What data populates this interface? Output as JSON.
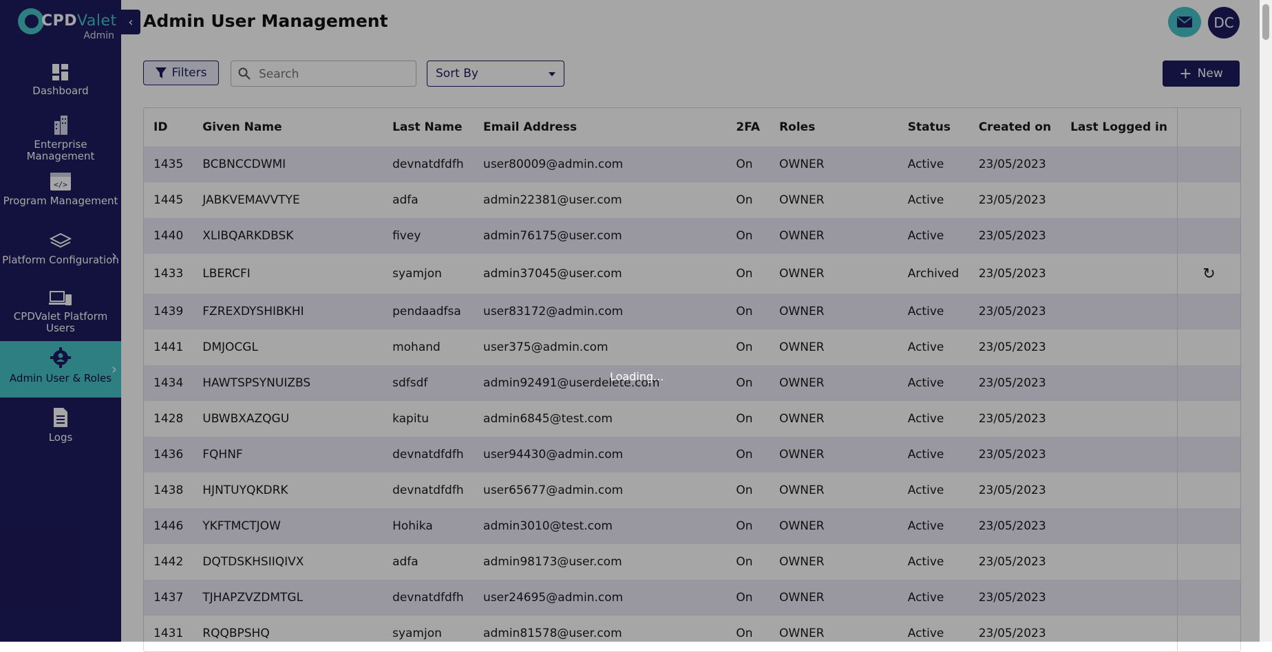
{
  "brand": {
    "name_prefix": "CPD",
    "name_suffix": "Valet",
    "sub": "Admin"
  },
  "sidebar": {
    "items": [
      {
        "label": "Dashboard",
        "icon": "dashboard-icon"
      },
      {
        "label": "Enterprise Management",
        "icon": "building-icon"
      },
      {
        "label": "Program Management",
        "icon": "code-window-icon"
      },
      {
        "label": "Platform Configuration",
        "icon": "layers-icon"
      },
      {
        "label": "CPDValet Platform Users",
        "icon": "devices-icon"
      },
      {
        "label": "Admin User & Roles",
        "icon": "admin-gear-icon"
      },
      {
        "label": "Logs",
        "icon": "document-icon"
      }
    ]
  },
  "header": {
    "title": "Admin User Management",
    "avatar_initials": "DC"
  },
  "toolbar": {
    "filters_label": "Filters",
    "search_placeholder": "Search",
    "sort_label": "Sort By",
    "new_label": "New"
  },
  "table": {
    "columns": [
      "ID",
      "Given Name",
      "Last Name",
      "Email Address",
      "2FA",
      "Roles",
      "Status",
      "Created on",
      "Last Logged in"
    ],
    "rows": [
      {
        "id": "1435",
        "given": "BCBNCCDWMI",
        "last": "devnatdfdfh",
        "email": "user80009@admin.com",
        "tfa": "On",
        "role": "OWNER",
        "status": "Active",
        "created": "23/05/2023",
        "logged": ""
      },
      {
        "id": "1445",
        "given": "JABKVEMAVVTYE",
        "last": "adfa",
        "email": "admin22381@user.com",
        "tfa": "On",
        "role": "OWNER",
        "status": "Active",
        "created": "23/05/2023",
        "logged": ""
      },
      {
        "id": "1440",
        "given": "XLIBQARKDBSK",
        "last": "fivey",
        "email": "admin76175@user.com",
        "tfa": "On",
        "role": "OWNER",
        "status": "Active",
        "created": "23/05/2023",
        "logged": ""
      },
      {
        "id": "1433",
        "given": "LBERCFI",
        "last": "syamjon",
        "email": "admin37045@user.com",
        "tfa": "On",
        "role": "OWNER",
        "status": "Archived",
        "created": "23/05/2023",
        "logged": ""
      },
      {
        "id": "1439",
        "given": "FZREXDYSHIBKHI",
        "last": "pendaadfsa",
        "email": "user83172@admin.com",
        "tfa": "On",
        "role": "OWNER",
        "status": "Active",
        "created": "23/05/2023",
        "logged": ""
      },
      {
        "id": "1441",
        "given": "DMJOCGL",
        "last": "mohand",
        "email": "user375@admin.com",
        "tfa": "On",
        "role": "OWNER",
        "status": "Active",
        "created": "23/05/2023",
        "logged": ""
      },
      {
        "id": "1434",
        "given": "HAWTSPSYNUIZBS",
        "last": "sdfsdf",
        "email": "admin92491@userdelete.com",
        "tfa": "On",
        "role": "OWNER",
        "status": "Active",
        "created": "23/05/2023",
        "logged": ""
      },
      {
        "id": "1428",
        "given": "UBWBXAZQGU",
        "last": "kapitu",
        "email": "admin6845@test.com",
        "tfa": "On",
        "role": "OWNER",
        "status": "Active",
        "created": "23/05/2023",
        "logged": ""
      },
      {
        "id": "1436",
        "given": "FQHNF",
        "last": "devnatdfdfh",
        "email": "user94430@admin.com",
        "tfa": "On",
        "role": "OWNER",
        "status": "Active",
        "created": "23/05/2023",
        "logged": ""
      },
      {
        "id": "1438",
        "given": "HJNTUYQKDRK",
        "last": "devnatdfdfh",
        "email": "user65677@admin.com",
        "tfa": "On",
        "role": "OWNER",
        "status": "Active",
        "created": "23/05/2023",
        "logged": ""
      },
      {
        "id": "1446",
        "given": "YKFTMCTJOW",
        "last": "Hohika",
        "email": "admin3010@test.com",
        "tfa": "On",
        "role": "OWNER",
        "status": "Active",
        "created": "23/05/2023",
        "logged": ""
      },
      {
        "id": "1442",
        "given": "DQTDSKHSIIQIVX",
        "last": "adfa",
        "email": "admin98173@user.com",
        "tfa": "On",
        "role": "OWNER",
        "status": "Active",
        "created": "23/05/2023",
        "logged": ""
      },
      {
        "id": "1437",
        "given": "TJHAPZVZDMTGL",
        "last": "devnatdfdfh",
        "email": "user24695@admin.com",
        "tfa": "On",
        "role": "OWNER",
        "status": "Active",
        "created": "23/05/2023",
        "logged": ""
      },
      {
        "id": "1431",
        "given": "RQQBPSHQ",
        "last": "syamjon",
        "email": "admin81578@user.com",
        "tfa": "On",
        "role": "OWNER",
        "status": "Active",
        "created": "23/05/2023",
        "logged": ""
      }
    ]
  },
  "overlay": {
    "loading_text": "Loading..."
  },
  "colors": {
    "sidebar": "#1e1b5e",
    "accent": "#46c3c6",
    "row_alt": "#eceaf8"
  }
}
